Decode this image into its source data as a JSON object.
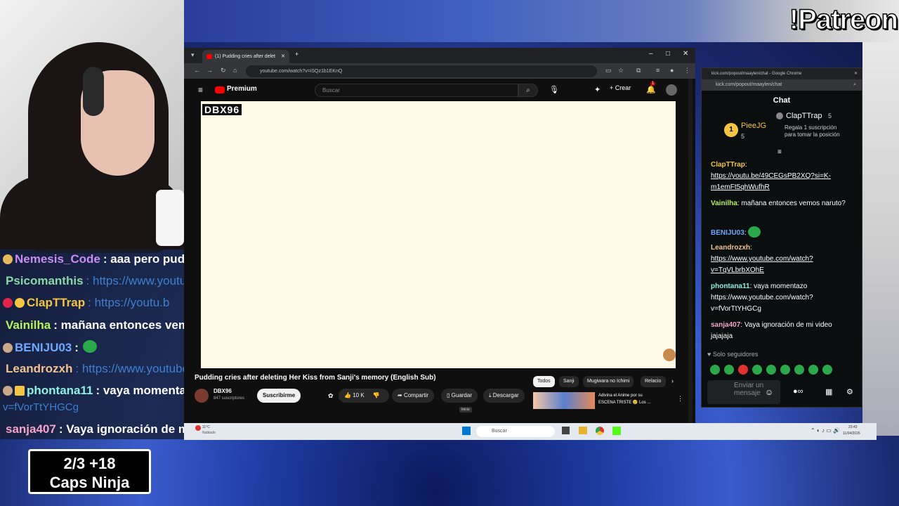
{
  "overlay": {
    "patreon_label": "!Patreon",
    "caps_line1": "2/3  +18",
    "caps_line2": "Caps Ninja",
    "chat": [
      {
        "user": "Nemesis_Code",
        "msg": ": aaa pero pudd",
        "color": "#c98cf2"
      },
      {
        "user": "Psicomanthis",
        "msg": ": https://www.youtu",
        "color": "#8bd6a9",
        "link": true
      },
      {
        "user": "ClapTTrap",
        "msg": ": https://youtu.b",
        "color": "#f4c542",
        "link": true
      },
      {
        "user": "Vainilha",
        "msg": ": mañana entonces vemo",
        "color": "#b7f15a"
      },
      {
        "user": "BENIJU03",
        "msg": ":",
        "color": "#6fa8ff"
      },
      {
        "user": "Leandrozxh",
        "msg": ": https://www.youtube",
        "color": "#f3c28f",
        "link": true
      },
      {
        "user": "phontana11",
        "msg": ": vaya momentaz",
        "color": "#8ff0e1"
      },
      {
        "user": "",
        "msg": "v=fVorTtYHGCg",
        "color": "#3e7fd1",
        "link": true
      },
      {
        "user": "sanja407",
        "msg": ": Vaya ignoración de mi",
        "color": "#f5a3c7"
      }
    ]
  },
  "browser": {
    "tab_title": "(1) Pudding cries after delet",
    "url": "youtube.com/watch?v=iSQz1b1EKnQ",
    "yt_brand": "Premium",
    "search_placeholder": "Buscar",
    "create_label": "Crear",
    "notif_count": "1",
    "watermark": "DBX96",
    "video_title": "Pudding cries after deleting Her Kiss from Sanji's memory (English Sub)",
    "channel_name": "DBX96",
    "subscribers": "847 suscriptores",
    "subscribe_label": "Suscribirme",
    "like_count": "10 K",
    "share_label": "Compartir",
    "save_label": "Guardar",
    "download_label": "Descargar",
    "chips": [
      "Todos",
      "Sanji",
      "Mugiwara no Ichimi",
      "Relacio"
    ],
    "rec_title": "Adivina el Anime por su",
    "rec_sub": "ESCENA TRISTE 😢 Los ...",
    "tooltip": "Inicio"
  },
  "taskbar": {
    "weather_temp": "11°C",
    "weather_desc": "Nublado",
    "search": "Buscar",
    "time": "23:43",
    "date": "11/04/2026"
  },
  "kick": {
    "window_title": "kick.com/popout/maaylen/chat - Google Chrome",
    "url": "kick.com/popout/maaylen/chat",
    "header": "Chat",
    "top_user": "PieeJG",
    "top_user_count": "5",
    "rank": "1",
    "gift_user": "ClapTTrap",
    "gift_count": "5",
    "gift_text": "Regala 1 suscripción para tomar la posición",
    "messages": [
      {
        "user": "ClapTTrap",
        "text": "https://youtu.be/49CEGsPB2XQ?si=K-m1emFt5qhWufhR",
        "color": "#f4c542",
        "link": true
      },
      {
        "user": "Vainilha",
        "text": "mañana entonces vemos naruto?",
        "color": "#b7f15a"
      },
      {
        "user": "BENIJU03",
        "text": "",
        "color": "#6fa8ff"
      },
      {
        "user": "Leandrozxh",
        "text": "https://www.youtube.com/watch?v=TqVLbrbXOhE",
        "color": "#f3c28f",
        "link": true
      },
      {
        "user": "phontana11",
        "text": "vaya momentazo https://www.youtube.com/watch?v=fVorTtYHGCg",
        "color": "#8ff0e1"
      },
      {
        "user": "sanja407",
        "text": "Vaya ignoración de mi video jajajaja",
        "color": "#f5a3c7"
      }
    ],
    "followers_only": "Solo seguidores",
    "input_placeholder": "Enviar un mensaje"
  },
  "colors": {
    "yt_red": "#ff0000",
    "kick_green": "#53fc18",
    "bg_blue": "#1e3aa0"
  }
}
